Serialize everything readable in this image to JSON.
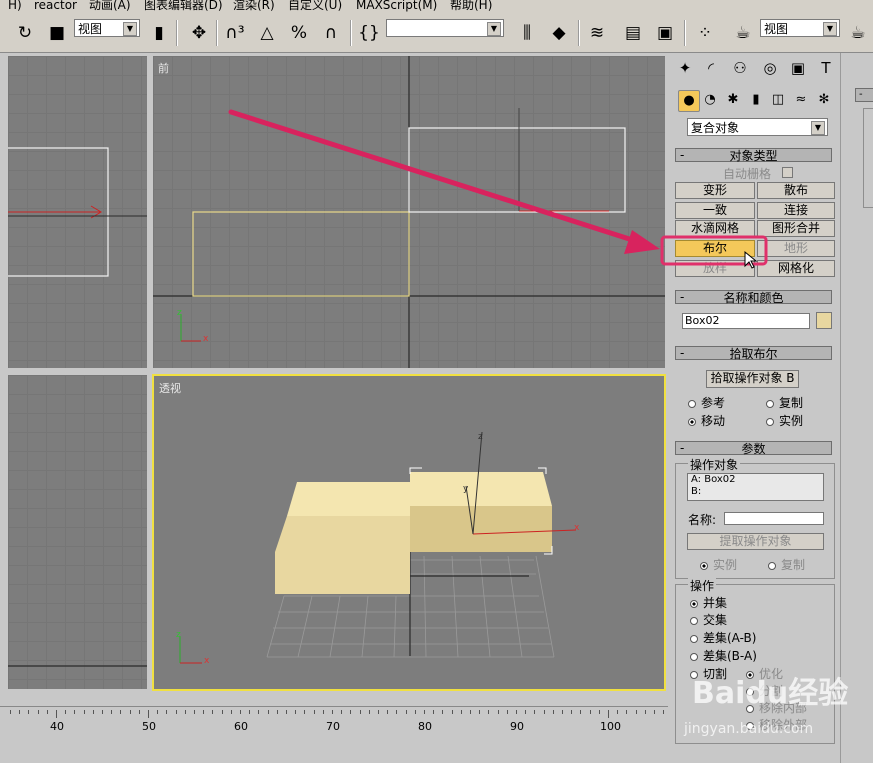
{
  "menu": [
    "H)",
    "reactor",
    "动画(A)",
    "图表编辑器(D)",
    "渲染(R)",
    "自定义(U)",
    "MAXScript(M)",
    "帮助(H)"
  ],
  "toolbar": {
    "view_select_1": "视图",
    "view_select_2": "视图",
    "selection_set": ""
  },
  "viewports": {
    "front_label": "前",
    "perspective_label": "透视",
    "axis_x": "x",
    "axis_y": "y",
    "axis_z": "z"
  },
  "panel": {
    "category_dropdown": "复合对象",
    "object_type": {
      "title": "对象类型",
      "autogrid": "自动栅格",
      "buttons": [
        {
          "label": "变形",
          "state": "normal"
        },
        {
          "label": "散布",
          "state": "normal"
        },
        {
          "label": "一致",
          "state": "normal"
        },
        {
          "label": "连接",
          "state": "normal"
        },
        {
          "label": "水滴网格",
          "state": "normal"
        },
        {
          "label": "图形合并",
          "state": "normal"
        },
        {
          "label": "布尔",
          "state": "active"
        },
        {
          "label": "地形",
          "state": "disabled"
        },
        {
          "label": "放样",
          "state": "disabled"
        },
        {
          "label": "网格化",
          "state": "normal"
        }
      ]
    },
    "name_color": {
      "title": "名称和颜色",
      "name_value": "Box02",
      "color": "#e8d7a0"
    },
    "pick_boolean": {
      "title": "拾取布尔",
      "pick_button": "拾取操作对象 B",
      "radio_reference": "参考",
      "radio_copy": "复制",
      "radio_move": "移动",
      "radio_instance": "实例"
    },
    "parameters": {
      "title": "参数",
      "operands_group": "操作对象",
      "operand_a": "A: Box02",
      "operand_b": "B:",
      "name_label": "名称:",
      "extract_button": "提取操作对象",
      "radio_instance": "实例",
      "radio_copy": "复制",
      "operation_group": "操作",
      "op_union": "并集",
      "op_intersection": "交集",
      "op_subtract_ab": "差集(A-B)",
      "op_subtract_ba": "差集(B-A)",
      "op_cut": "切割",
      "cut_refine": "优化",
      "cut_split": "分割",
      "cut_remove_inside": "移除内部",
      "cut_remove_outside": "移除外部"
    }
  },
  "ruler": {
    "labels": [
      "40",
      "50",
      "60",
      "70",
      "80",
      "90",
      "100"
    ]
  },
  "colors": {
    "highlight_box": "#e0306a",
    "arrow": "#d8235e",
    "active_viewport_border": "#f0e040",
    "active_button": "#f4c85a"
  },
  "watermark": {
    "brand": "Baidu经验",
    "url": "jingyan.baidu.com"
  }
}
